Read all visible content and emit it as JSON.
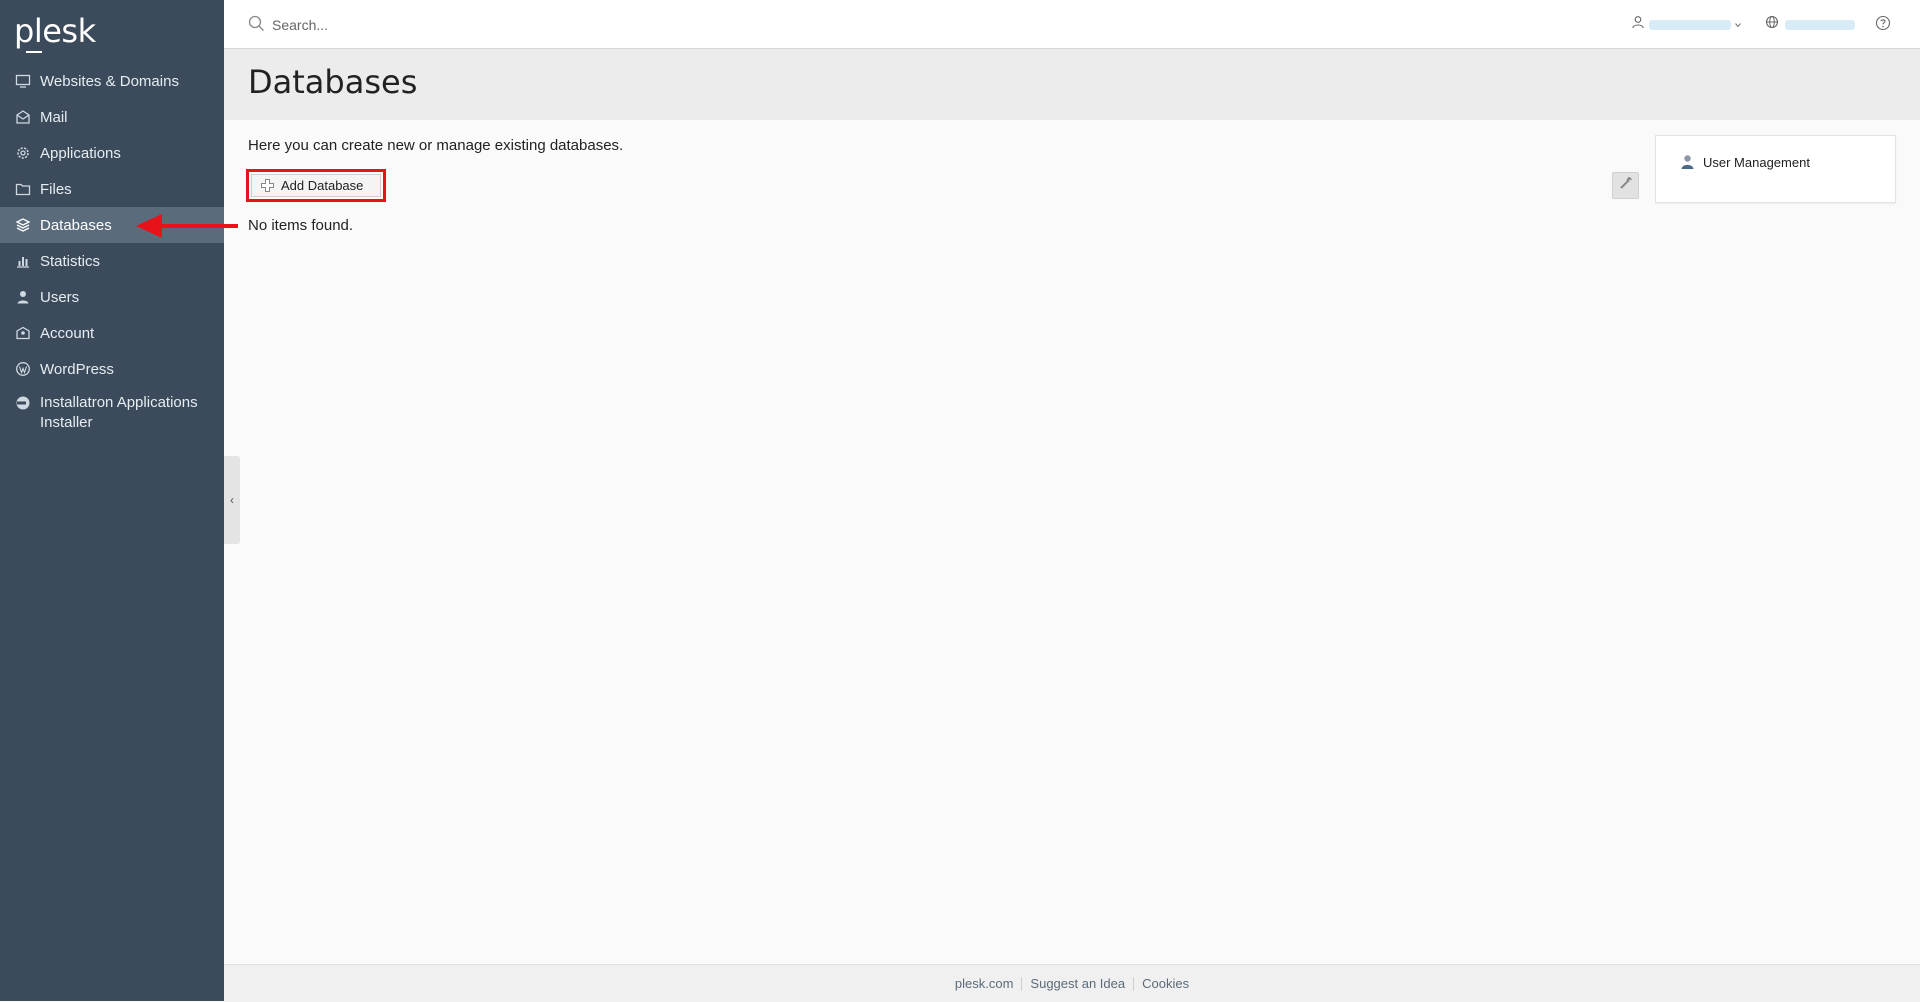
{
  "app": {
    "logo": "plesk"
  },
  "search": {
    "placeholder": "Search..."
  },
  "sidebar": {
    "items": [
      {
        "label": "Websites & Domains",
        "icon": "monitor-icon"
      },
      {
        "label": "Mail",
        "icon": "mail-icon"
      },
      {
        "label": "Applications",
        "icon": "gear-icon"
      },
      {
        "label": "Files",
        "icon": "folder-icon"
      },
      {
        "label": "Databases",
        "icon": "database-icon",
        "active": true
      },
      {
        "label": "Statistics",
        "icon": "bar-chart-icon"
      },
      {
        "label": "Users",
        "icon": "user-icon"
      },
      {
        "label": "Account",
        "icon": "account-icon"
      },
      {
        "label": "WordPress",
        "icon": "wordpress-icon"
      },
      {
        "label": "Installatron Applications Installer",
        "icon": "installatron-icon"
      }
    ]
  },
  "main": {
    "title": "Databases",
    "intro": "Here you can create new or manage existing databases.",
    "add_button": "Add Database",
    "empty": "No items found."
  },
  "side_panel": {
    "user_management": "User Management"
  },
  "footer": {
    "links": [
      "plesk.com",
      "Suggest an Idea",
      "Cookies"
    ]
  },
  "colors": {
    "sidebar_bg": "#3b4b5b",
    "sidebar_active": "#5a6b7c",
    "highlight": "#e8121b"
  }
}
